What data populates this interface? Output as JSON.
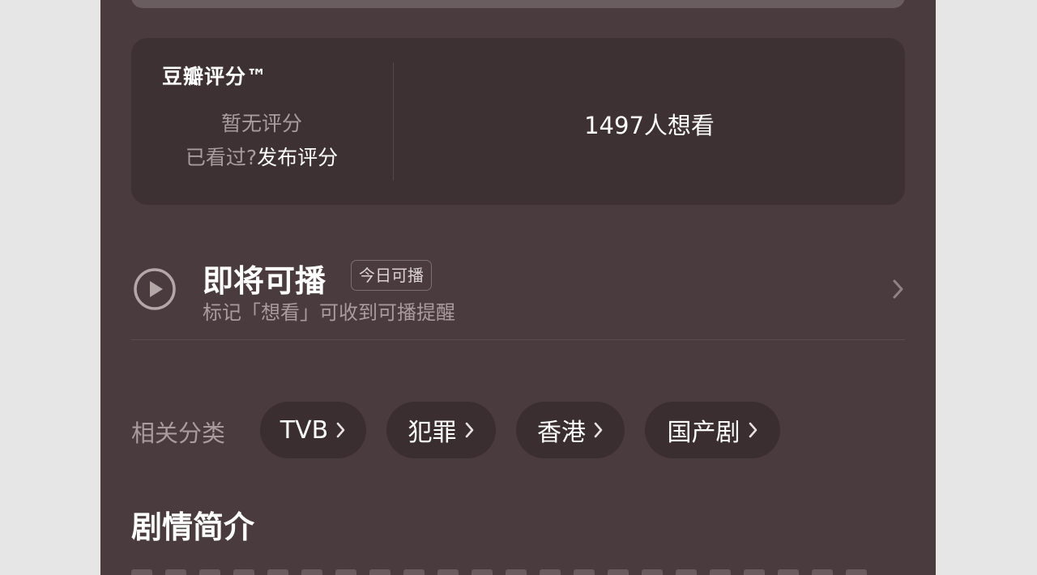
{
  "rating": {
    "brand": "豆瓣评分™",
    "no_rating": "暂无评分",
    "seen_question": "已看过?",
    "publish_label": "发布评分",
    "want_count": "1497人想看"
  },
  "playable": {
    "title": "即将可播",
    "badge": "今日可播",
    "subtitle": "标记「想看」可收到可播提醒"
  },
  "categories": {
    "label": "相关分类",
    "tags": [
      "TVB",
      "犯罪",
      "香港",
      "国产剧"
    ]
  },
  "synopsis": {
    "title": "剧情简介"
  }
}
